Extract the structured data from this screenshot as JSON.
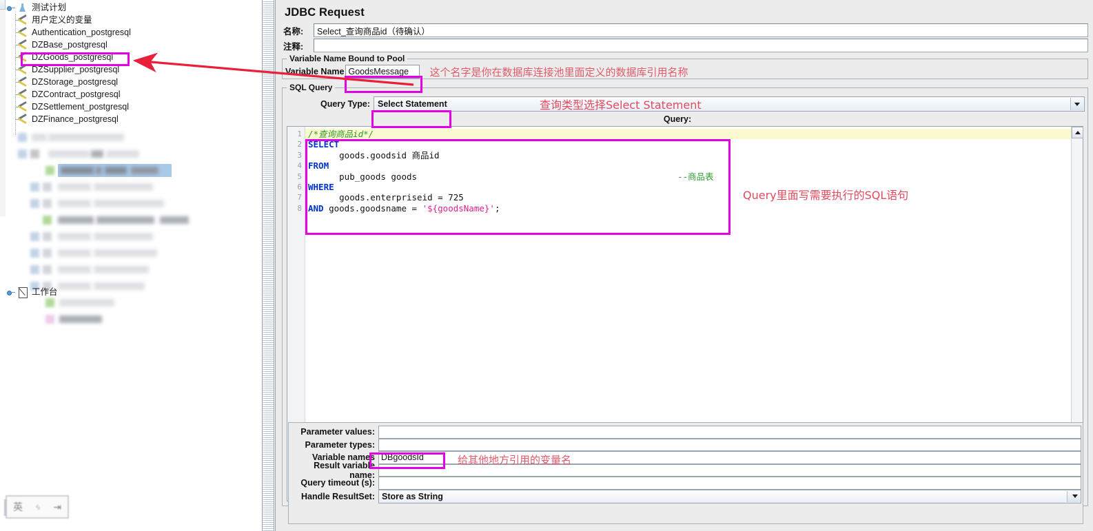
{
  "tree": {
    "root_label": "测试计划",
    "items": [
      {
        "label": "用户定义的变量",
        "icon": "wrench-icon"
      },
      {
        "label": "Authentication_postgresql",
        "icon": "wrench-icon"
      },
      {
        "label": "DZBase_postgresql",
        "icon": "wrench-icon"
      },
      {
        "label": "DZGoods_postgresql",
        "icon": "wrench-icon",
        "highlighted": true
      },
      {
        "label": "DZSupplier_postgresql",
        "icon": "wrench-icon"
      },
      {
        "label": "DZStorage_postgresql",
        "icon": "wrench-icon"
      },
      {
        "label": "DZContract_postgresql",
        "icon": "wrench-icon"
      },
      {
        "label": "DZSettlement_postgresql",
        "icon": "wrench-icon"
      },
      {
        "label": "DZFinance_postgresql",
        "icon": "wrench-icon"
      }
    ],
    "redacted_count": 13,
    "workbench_label": "工作台"
  },
  "ime": {
    "glyph_a": "英",
    "glyph_b": "ᛃ",
    "glyph_c": "⇥"
  },
  "panel": {
    "title": "JDBC Request",
    "name_label": "名称:",
    "name_value": "Select_查询商品id（待确认）",
    "comment_label": "注释:",
    "comment_value": ""
  },
  "pool": {
    "legend": "Variable Name Bound to Pool",
    "label": "Variable Name",
    "value": "GoodsMessage",
    "annotation": "这个名字是你在数据库连接池里面定义的数据库引用名称"
  },
  "sql": {
    "legend": "SQL Query",
    "query_type_label": "Query Type:",
    "query_type_value": "Select Statement",
    "query_type_annotation": "查询类型选择Select Statement",
    "query_caption": "Query:",
    "editor_annotation": "Query里面写需要执行的SQL语句",
    "line_numbers": [
      "1",
      "2",
      "3",
      "4",
      "5",
      "6",
      "7",
      "8"
    ],
    "lines": [
      {
        "n": 1,
        "current": true,
        "tokens": [
          {
            "t": "cmt",
            "v": "/*查询商品id*/"
          }
        ]
      },
      {
        "n": 2,
        "tokens": [
          {
            "t": "kw",
            "v": "SELECT"
          }
        ]
      },
      {
        "n": 3,
        "tokens": [
          {
            "t": "plain",
            "v": "      goods.goodsid 商品id"
          }
        ]
      },
      {
        "n": 4,
        "tokens": [
          {
            "t": "kw",
            "v": "FROM"
          }
        ]
      },
      {
        "n": 5,
        "tokens": [
          {
            "t": "plain",
            "v": "      pub_goods goods"
          }
        ],
        "right": {
          "t": "cmt2",
          "v": "--商品表"
        }
      },
      {
        "n": 6,
        "tokens": [
          {
            "t": "kw",
            "v": "WHERE"
          }
        ]
      },
      {
        "n": 7,
        "tokens": [
          {
            "t": "plain",
            "v": "      goods.enterpriseid = 725"
          }
        ]
      },
      {
        "n": 8,
        "tokens": [
          {
            "t": "kw",
            "v": "AND"
          },
          {
            "t": "plain",
            "v": " goods.goodsname = "
          },
          {
            "t": "str",
            "v": "'${goodsName}'"
          },
          {
            "t": "plain",
            "v": ";"
          }
        ]
      }
    ]
  },
  "params": {
    "rows": [
      {
        "label": "Parameter values:",
        "value": "",
        "type": "input"
      },
      {
        "label": "Parameter types:",
        "value": "",
        "type": "input"
      },
      {
        "label": "Variable names",
        "value": "DBgoodsId",
        "type": "input",
        "boxed": true
      },
      {
        "label": "Result variable name:",
        "value": "",
        "type": "input"
      },
      {
        "label": "Query timeout (s):",
        "value": "",
        "type": "input"
      },
      {
        "label": "Handle ResultSet:",
        "value": "Store as String",
        "type": "combo"
      }
    ],
    "variable_names_annotation": "给其他地方引用的变量名"
  },
  "colors": {
    "annotation_magenta": "#e300e3",
    "annotation_red": "#e04b5f",
    "arrow_red": "#e8213a",
    "keyword_blue": "#0033cc",
    "comment_green": "#2f9a2f",
    "string_pink": "#e0208c",
    "selection_blue": "#a9c9e8",
    "current_line_yellow": "#fbf9cf",
    "panel_gray": "#ececec"
  }
}
